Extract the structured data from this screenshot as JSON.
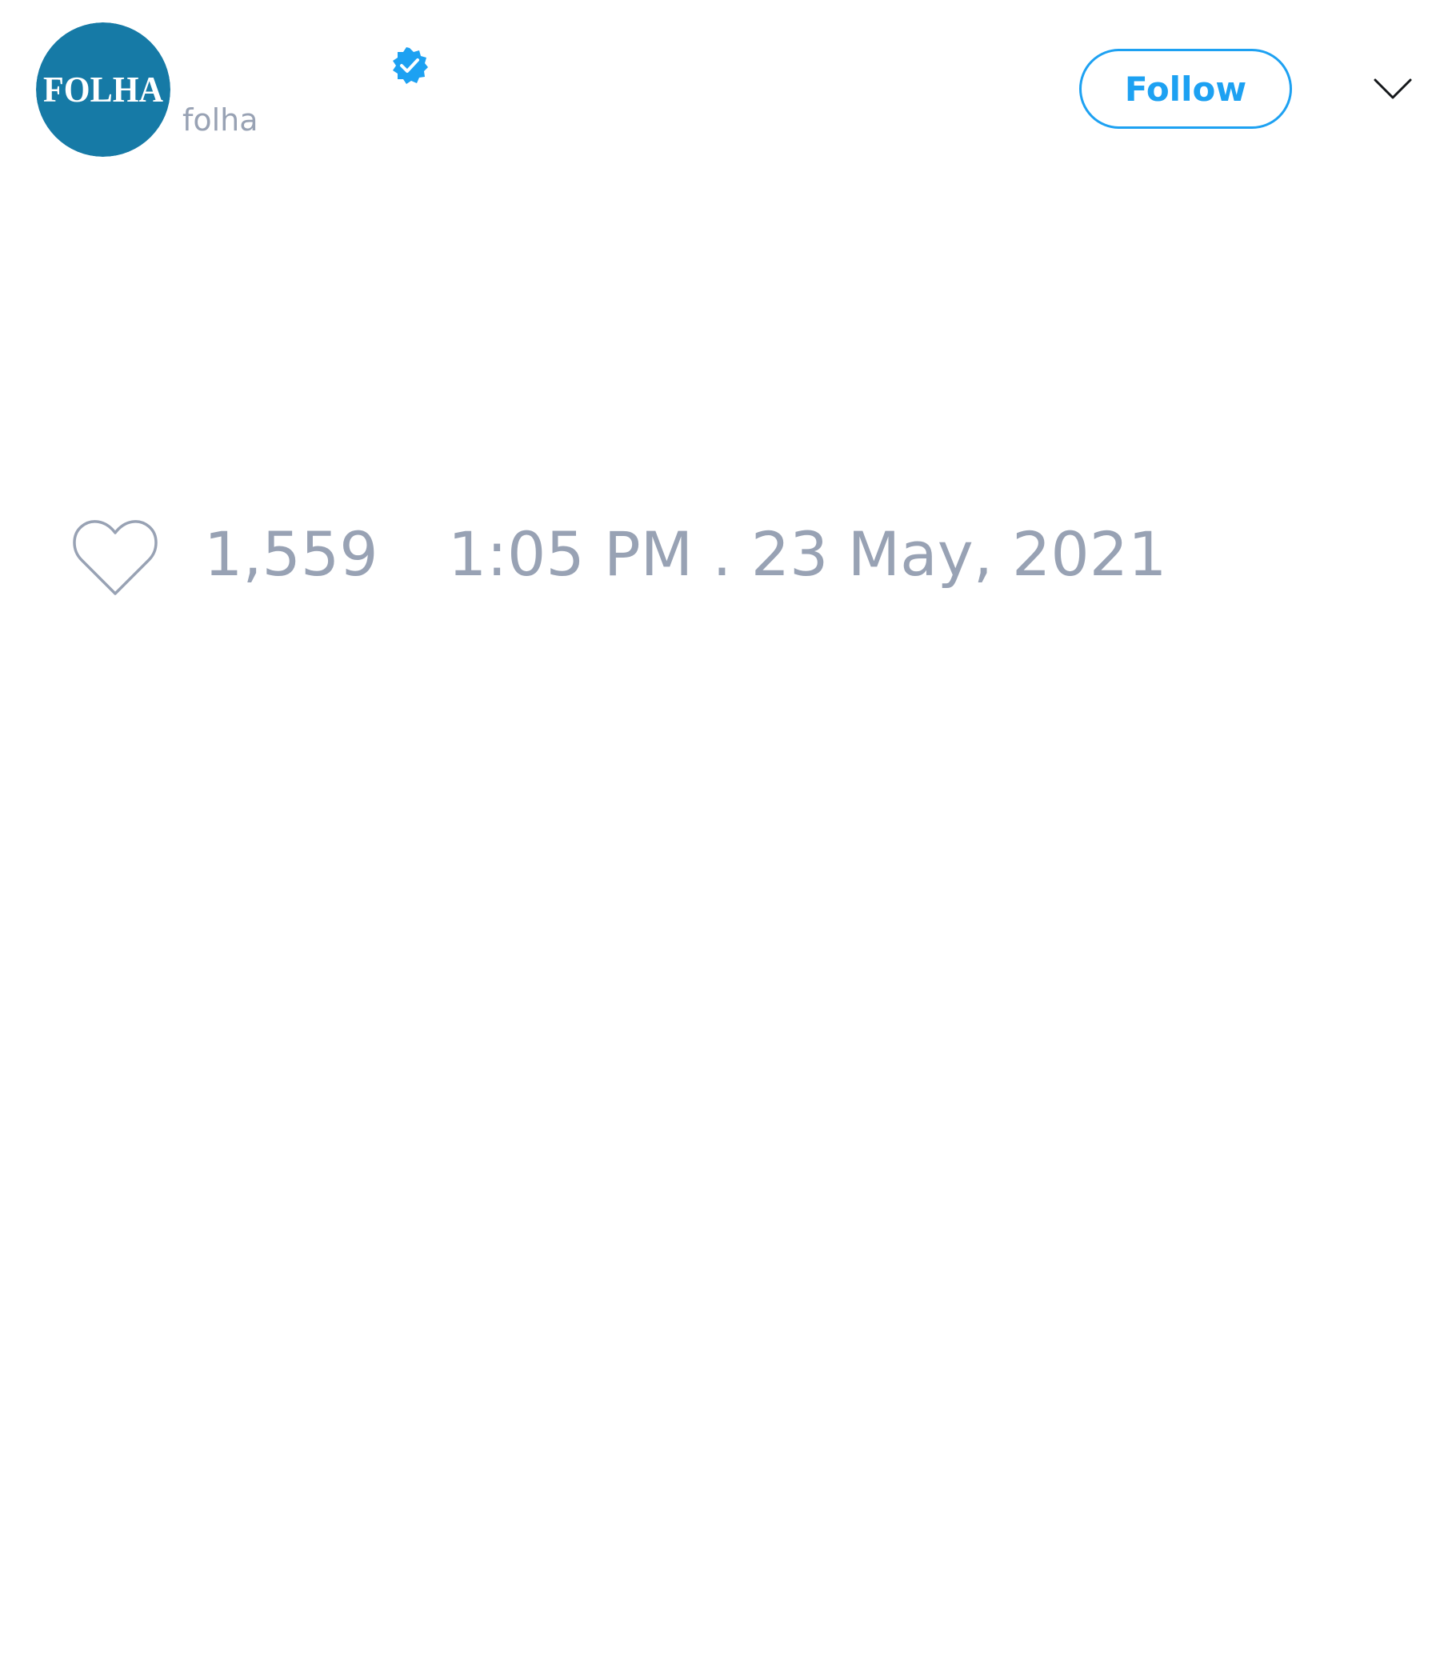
{
  "author": {
    "avatar_logo_text": "FOLHA",
    "handle": "folha",
    "verified": true,
    "verified_icon": "verified-badge-icon"
  },
  "header": {
    "follow_label": "Follow",
    "menu_icon": "chevron-down-icon"
  },
  "footer": {
    "like_icon": "heart-outline-icon",
    "like_count": "1,559",
    "timestamp": "1:05 PM . 23 May, 2021"
  },
  "colors": {
    "accent": "#1da1f2",
    "muted_text": "#98a2b4",
    "avatar_bg": "#167aa6",
    "background": "#ffffff"
  }
}
